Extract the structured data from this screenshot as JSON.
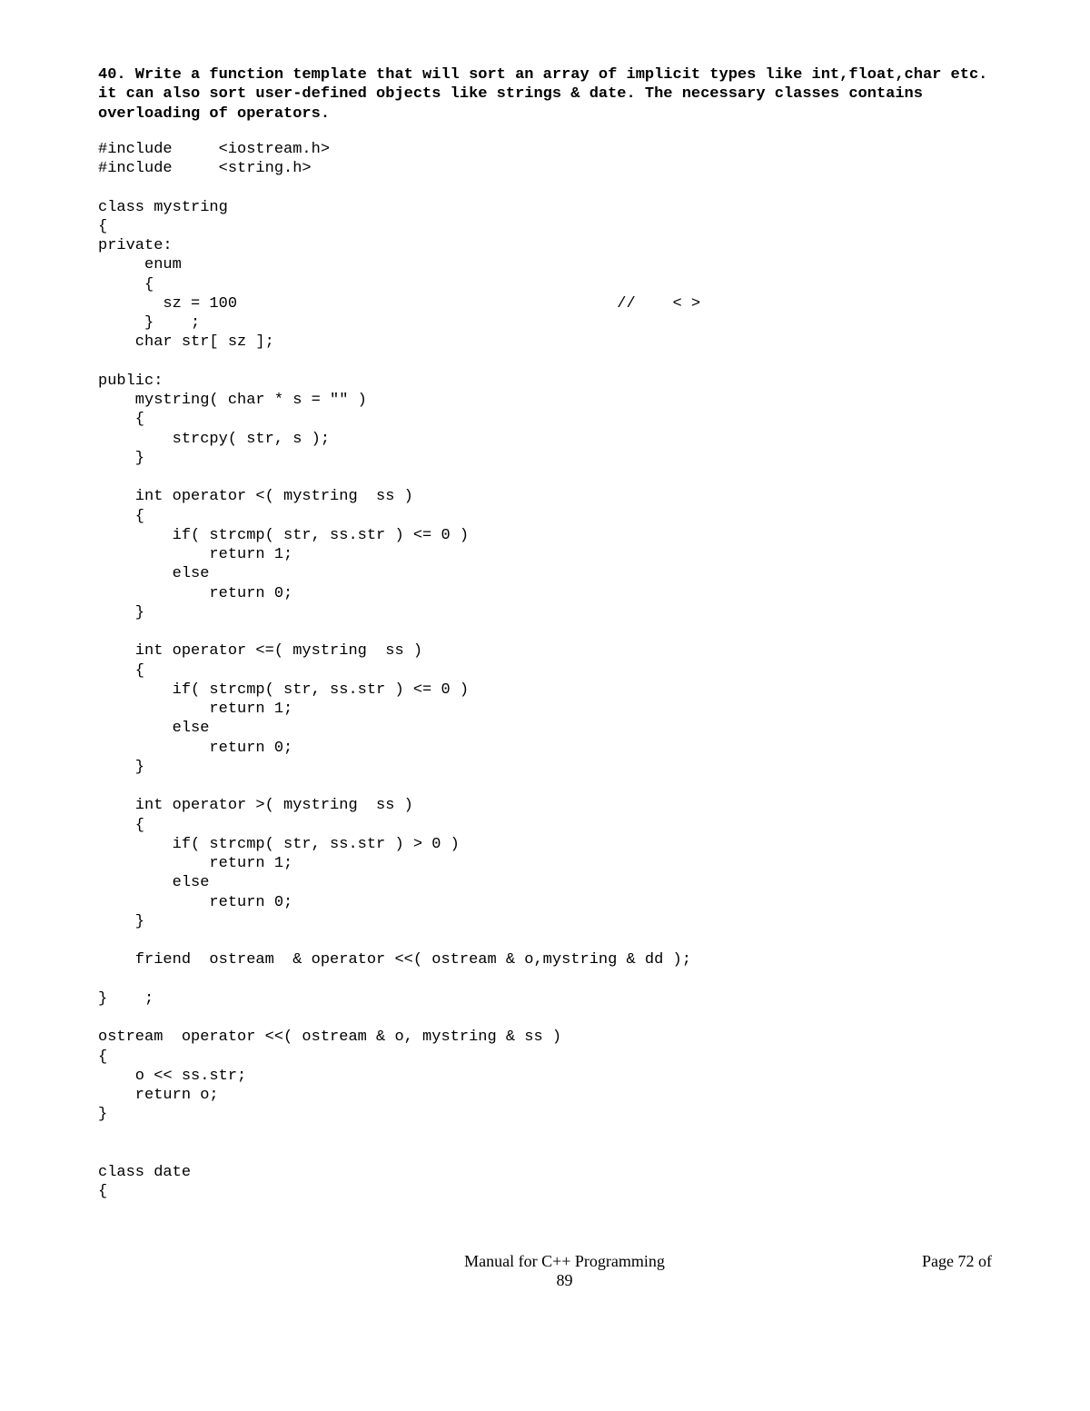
{
  "question": "40. Write a function template that will sort an array of implicit types like int,float,char etc. it can also sort user-defined objects like strings & date. The necessary classes contains overloading of operators.",
  "code": "#include     <iostream.h>\n#include     <string.h>\n\nclass mystring\n{\nprivate:\n     enum\n     {\n       sz = 100                                         //    < >\n     }    ;\n    char str[ sz ];\n\npublic:\n    mystring( char * s = \"\" )\n    {\n        strcpy( str, s );\n    }\n\n    int operator <( mystring  ss )\n    {\n        if( strcmp( str, ss.str ) <= 0 )\n            return 1;\n        else\n            return 0;\n    }\n\n    int operator <=( mystring  ss )\n    {\n        if( strcmp( str, ss.str ) <= 0 )\n            return 1;\n        else\n            return 0;\n    }\n\n    int operator >( mystring  ss )\n    {\n        if( strcmp( str, ss.str ) > 0 )\n            return 1;\n        else\n            return 0;\n    }\n\n    friend  ostream  & operator <<( ostream & o,mystring & dd );\n\n}    ;\n\nostream  operator <<( ostream & o, mystring & ss )\n{\n    o << ss.str;\n    return o;\n}\n\n\nclass date\n{",
  "footer": {
    "title": "Manual for C++ Programming",
    "page_label": "Page 72 of",
    "page_total": "89"
  }
}
